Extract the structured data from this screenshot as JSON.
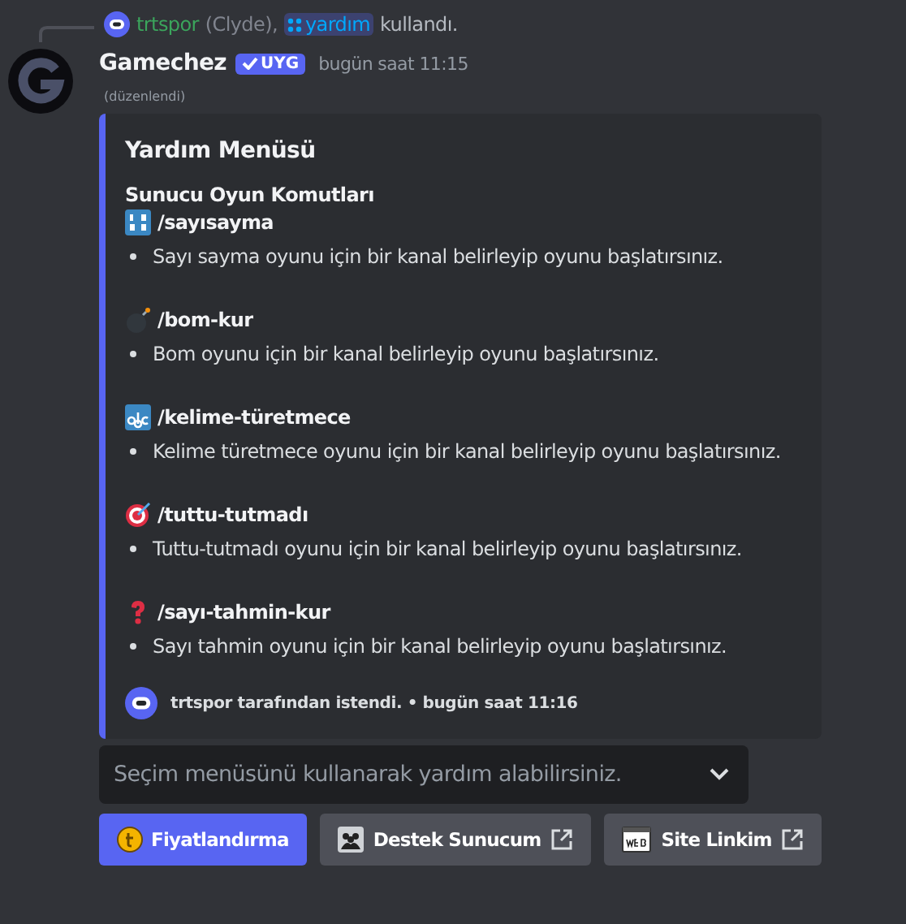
{
  "reply": {
    "user": "trtspor",
    "bot_note": "(Clyde),",
    "command": "yardım",
    "action": "kullandı."
  },
  "message": {
    "author": "Gamechez",
    "badge": "UYG",
    "time": "bugün saat 11:15",
    "edited": "(düzenlendi)"
  },
  "embed": {
    "title": "Yardım Menüsü",
    "section": "Sunucu Oyun Komutları",
    "commands": [
      {
        "name": "/sayısayma",
        "description": "Sayı sayma oyunu için bir kanal belirleyip oyunu başlatırsınız."
      },
      {
        "name": "/bom-kur",
        "description": "Bom oyunu için bir kanal belirleyip oyunu başlatırsınız."
      },
      {
        "name": "/kelime-türetmece",
        "description": "Kelime türetmece oyunu için bir kanal belirleyip oyunu başlatırsınız."
      },
      {
        "name": "/tuttu-tutmadı",
        "description": "Tuttu-tutmadı oyunu için bir kanal belirleyip oyunu başlatırsınız."
      },
      {
        "name": "/sayı-tahmin-kur",
        "description": "Sayı tahmin oyunu için bir kanal belirleyip oyunu başlatırsınız."
      }
    ],
    "footer": "trtspor tarafından istendi. • bugün saat 11:16"
  },
  "select": {
    "placeholder": "Seçim menüsünü kullanarak yardım alabilirsiniz."
  },
  "buttons": [
    {
      "label": "Fiyatlandırma",
      "kind": "primary",
      "external": false
    },
    {
      "label": "Destek Sunucum",
      "kind": "link",
      "external": true
    },
    {
      "label": "Site Linkim",
      "kind": "link",
      "external": true
    }
  ]
}
